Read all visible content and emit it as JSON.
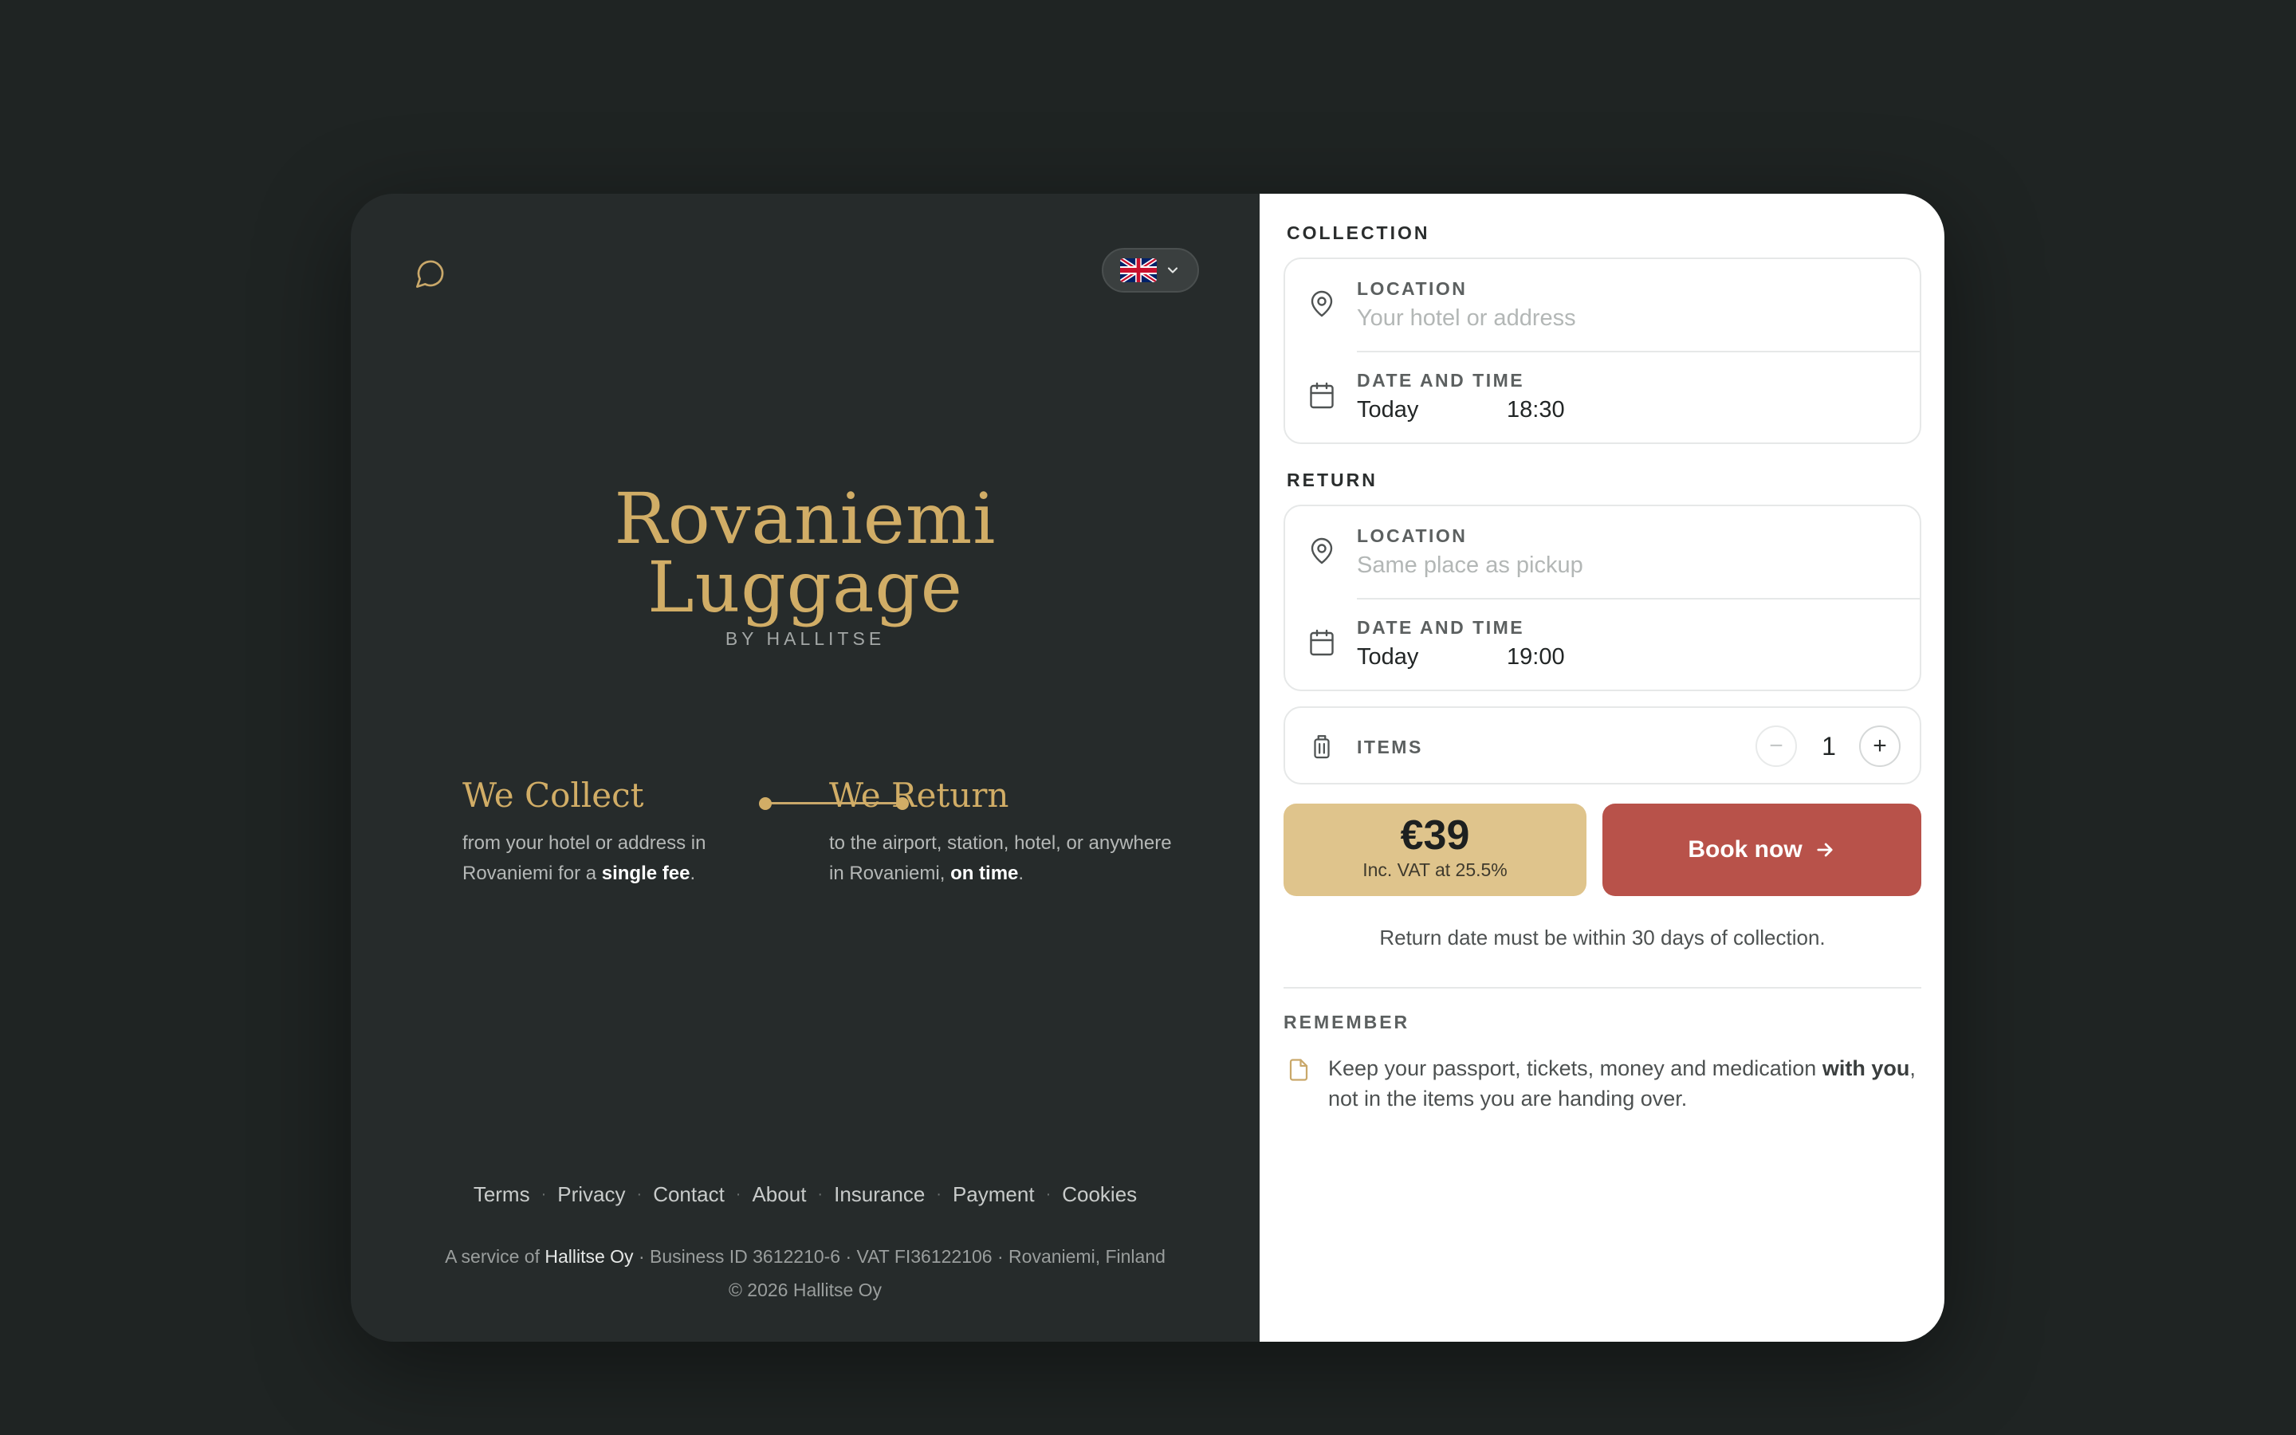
{
  "left": {
    "brand": {
      "title_line1": "Rovaniemi",
      "title_line2": "Luggage",
      "subtitle": "BY HALLITSE"
    },
    "language": {
      "flag": "uk-flag-icon"
    },
    "steps": {
      "collect": {
        "title": "We Collect",
        "desc_pre": "from your hotel or address in Rovaniemi for a ",
        "desc_bold": "single fee",
        "desc_post": "."
      },
      "return": {
        "title": "We Return",
        "desc_pre": "to the airport, station, hotel, or anywhere in Rovaniemi, ",
        "desc_bold": "on time",
        "desc_post": "."
      }
    },
    "footer": {
      "links": [
        "Terms",
        "Privacy",
        "Contact",
        "About",
        "Insurance",
        "Payment",
        "Cookies"
      ],
      "separator": "·",
      "info_prefix": "A service of ",
      "company": "Hallitse Oy",
      "info_rest": " · Business ID 3612210-6 · VAT FI36122106 · Rovaniemi, Finland",
      "copyright": "© 2026 Hallitse Oy"
    }
  },
  "collection": {
    "label": "COLLECTION",
    "location_label": "LOCATION",
    "location_placeholder": "Your hotel or address",
    "datetime_label": "DATE AND TIME",
    "date": "Today",
    "time": "18:30"
  },
  "return": {
    "label": "RETURN",
    "location_label": "LOCATION",
    "location_placeholder": "Same place as pickup",
    "datetime_label": "DATE AND TIME",
    "date": "Today",
    "time": "19:00"
  },
  "items": {
    "label": "ITEMS",
    "count": "1",
    "minus": "−",
    "plus": "+"
  },
  "price": {
    "amount": "€39",
    "vat": "Inc. VAT at 25.5%"
  },
  "book": {
    "label": "Book now"
  },
  "note": "Return date must be within 30 days of collection.",
  "remember": {
    "label": "REMEMBER",
    "text_pre": "Keep your passport, tickets, money and medication ",
    "text_bold": "with you",
    "text_post": ", not in the items you are handing over."
  },
  "colors": {
    "gold": "#d1ad66",
    "dark_bg": "#262b2b",
    "book_red": "#b8524a",
    "price_gold": "#dfc48c"
  }
}
